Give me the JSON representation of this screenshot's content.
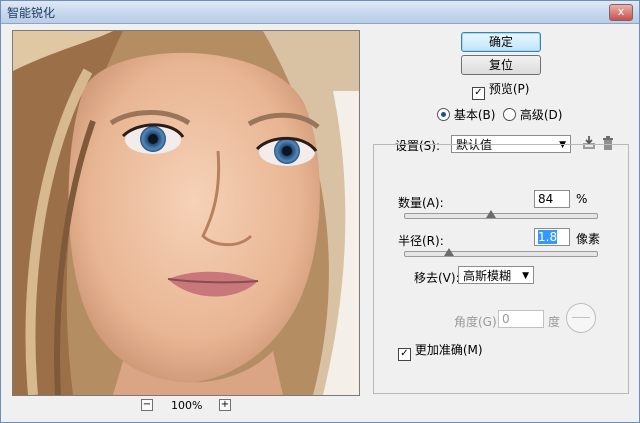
{
  "window": {
    "title": "智能锐化",
    "close_label": "x"
  },
  "preview": {
    "zoom_out": "−",
    "zoom_in": "+",
    "zoom_level": "100%"
  },
  "buttons": {
    "ok": "确定",
    "reset": "复位"
  },
  "preview_option": {
    "label": "预览(P)",
    "checked": true
  },
  "mode": {
    "basic": "基本(B)",
    "advanced": "高级(D)",
    "selected": "basic"
  },
  "settings": {
    "label": "设置(S):",
    "value": "默认值",
    "save_icon": "save-settings-icon",
    "delete_icon": "trash-icon"
  },
  "amount": {
    "label": "数量(A):",
    "value": "84",
    "unit": "%"
  },
  "radius": {
    "label": "半径(R):",
    "value": "1.8",
    "unit": "像素"
  },
  "remove": {
    "label": "移去(V):",
    "value": "高斯模糊"
  },
  "angle": {
    "label": "角度(G):",
    "value": "0",
    "unit": "度"
  },
  "accurate": {
    "label": "更加准确(M)",
    "checked": true
  },
  "colors": {
    "accent": "#1b4e9b",
    "title_bg": "#c7d8ee"
  }
}
